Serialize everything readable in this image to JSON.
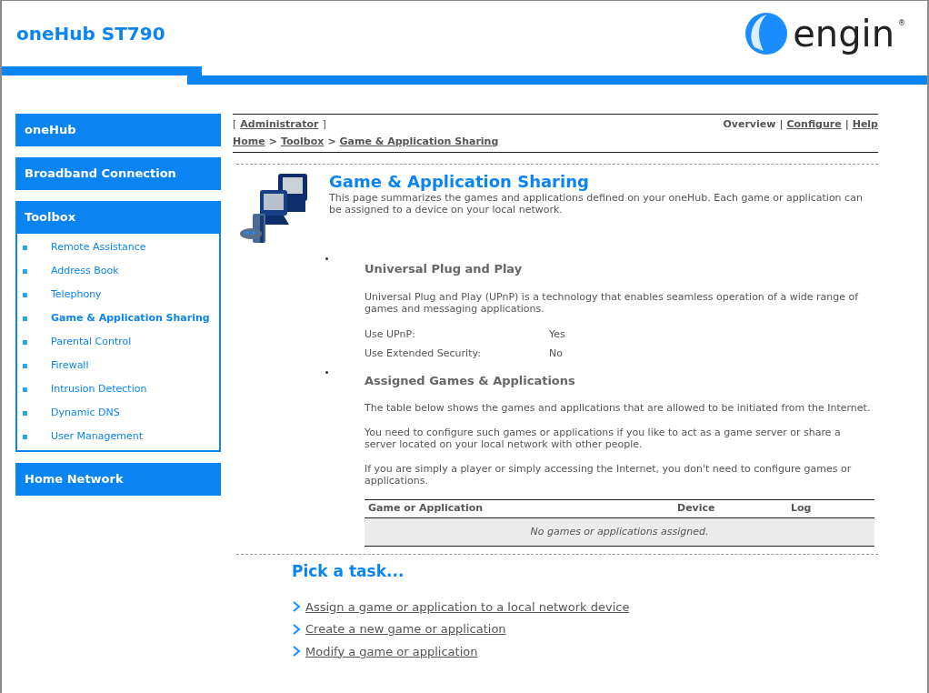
{
  "header": {
    "title": "oneHub ST790",
    "logo_text": "engin",
    "logo_mark": "®"
  },
  "sidebar": {
    "sections": [
      {
        "label": "oneHub"
      },
      {
        "label": "Broadband Connection"
      },
      {
        "label": "Toolbox",
        "items": [
          {
            "label": "Remote Assistance",
            "selected": false
          },
          {
            "label": "Address Book",
            "selected": false
          },
          {
            "label": "Telephony",
            "selected": false
          },
          {
            "label": "Game & Application Sharing",
            "selected": true
          },
          {
            "label": "Parental Control",
            "selected": false
          },
          {
            "label": "Firewall",
            "selected": false
          },
          {
            "label": "Intrusion Detection",
            "selected": false
          },
          {
            "label": "Dynamic DNS",
            "selected": false
          },
          {
            "label": "User Management",
            "selected": false
          }
        ]
      },
      {
        "label": "Home Network"
      }
    ]
  },
  "topbar": {
    "bracket_open": "[",
    "user": "Administrator",
    "bracket_close": "]",
    "separator": "|",
    "nav": [
      {
        "label": "Overview",
        "selected": true
      },
      {
        "label": "Configure",
        "selected": false
      },
      {
        "label": "Help",
        "selected": false
      }
    ],
    "breadcrumb_separator": ">",
    "breadcrumb": [
      "Home",
      "Toolbox",
      "Game & Application Sharing"
    ]
  },
  "page": {
    "title": "Game & Application Sharing",
    "description": "This page summarizes the games and applications defined on your oneHub. Each game or application can be assigned to a device on your local network."
  },
  "upnp": {
    "heading": "Universal Plug and Play",
    "description": "Universal Plug and Play (UPnP) is a technology that enables seamless operation of a wide range of games and messaging applications.",
    "settings": [
      {
        "label": "Use UPnP:",
        "value": "Yes"
      },
      {
        "label": "Use Extended Security:",
        "value": "No"
      }
    ]
  },
  "assigned": {
    "heading": "Assigned Games & Applications",
    "paragraphs": [
      "The table below shows the games and applications that are allowed to be initiated from the Internet.",
      "You need to configure such games or applications if you like to act as a game server or share a server located on your local network with other people.",
      "If you are simply a player or simply accessing the Internet, you don't need to configure games or applications."
    ],
    "table": {
      "columns": [
        "Game or Application",
        "Device",
        "Log"
      ],
      "empty_message": "No games or applications assigned."
    }
  },
  "tasks": {
    "title": "Pick a task...",
    "items": [
      "Assign a game or application to a local network device",
      "Create a new game or application",
      "Modify a game or application"
    ]
  }
}
